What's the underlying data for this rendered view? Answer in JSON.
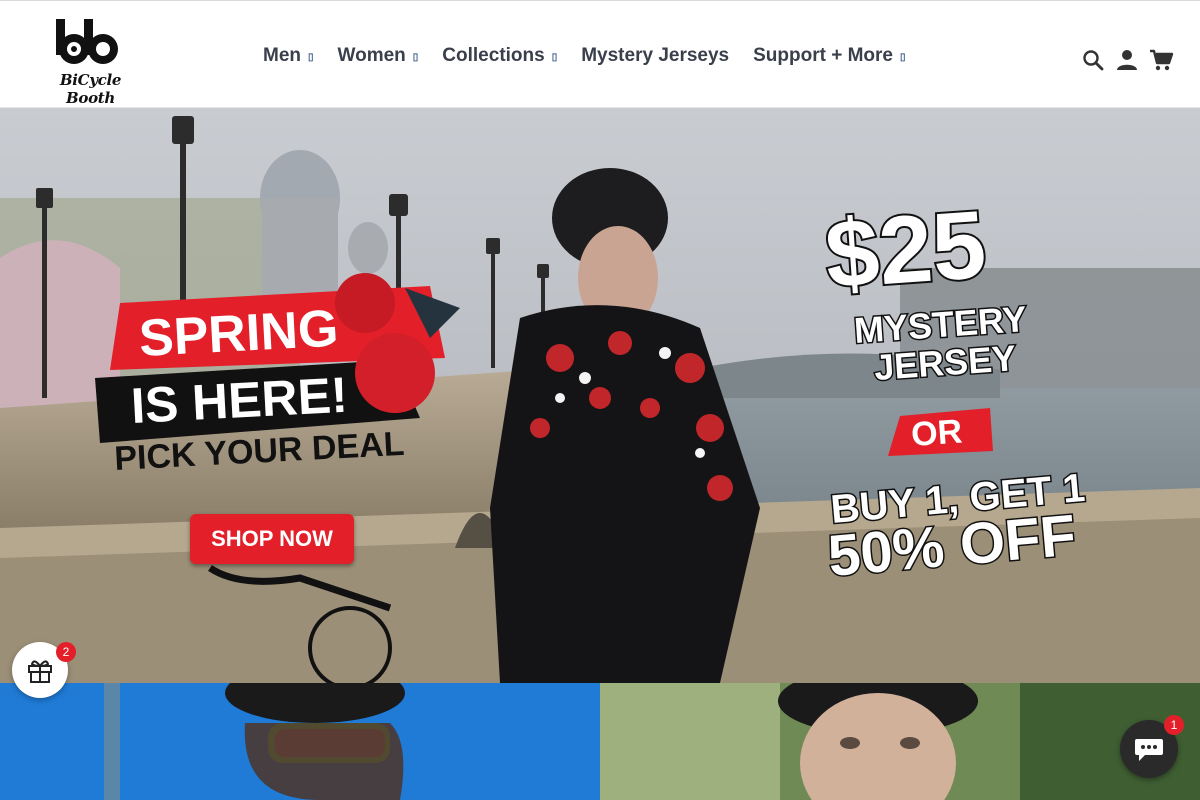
{
  "brand": {
    "logo_text": "BiCycle Booth"
  },
  "nav": {
    "items": [
      {
        "label": "Men",
        "has_dropdown": true
      },
      {
        "label": "Women",
        "has_dropdown": true
      },
      {
        "label": "Collections",
        "has_dropdown": true
      },
      {
        "label": "Mystery Jerseys",
        "has_dropdown": false
      },
      {
        "label": "Support + More",
        "has_dropdown": true
      }
    ],
    "caret_glyph": "▯"
  },
  "header_icons": [
    "search-icon",
    "account-icon",
    "cart-icon"
  ],
  "hero": {
    "headline_1": "SPRING",
    "headline_2": "IS HERE!",
    "headline_3": "PICK YOUR DEAL",
    "cta": "SHOP NOW",
    "price": "$25",
    "offer_1_line1": "MYSTERY",
    "offer_1_line2": "JERSEY",
    "or": "OR",
    "offer_2_line1": "BUY 1, GET 1",
    "offer_2_line2": "50% OFF"
  },
  "gift_widget": {
    "count": "2"
  },
  "chat_widget": {
    "count": "1"
  },
  "colors": {
    "accent_red": "#e3202a",
    "nav_text": "#3a3f4b",
    "dark": "#1a1a1a"
  }
}
